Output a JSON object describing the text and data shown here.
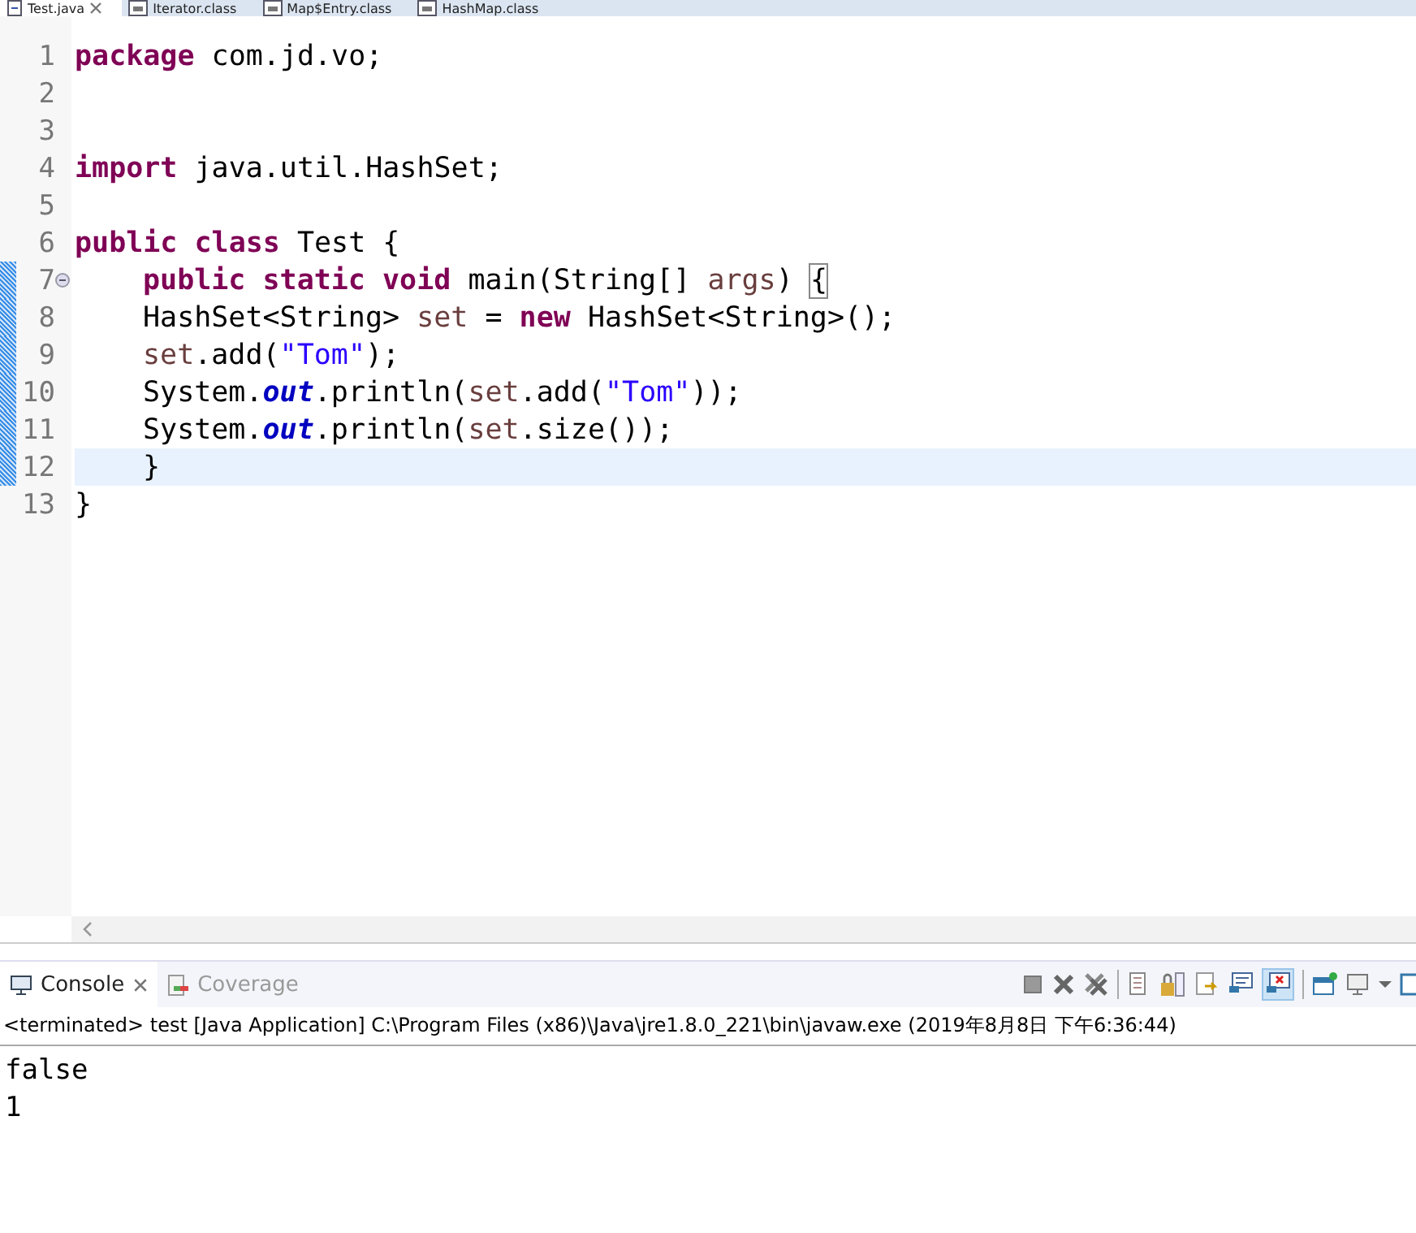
{
  "editor_tabs": [
    {
      "label": "Test.java",
      "selected": true,
      "closable": true
    },
    {
      "label": "Iterator.class",
      "selected": false,
      "closable": false
    },
    {
      "label": "Map$Entry.class",
      "selected": false,
      "closable": false
    },
    {
      "label": "HashMap.class",
      "selected": false,
      "closable": false
    }
  ],
  "code_lines": [
    {
      "number": "1",
      "changed": false,
      "current": false,
      "fold": false,
      "indent": false,
      "tokens": [
        {
          "kind": "kw",
          "text": "package"
        },
        {
          "kind": "txt",
          "text": " com.jd.vo;"
        }
      ]
    },
    {
      "number": "2",
      "changed": false,
      "current": false,
      "fold": false,
      "indent": false
    },
    {
      "number": "3",
      "changed": false,
      "current": false,
      "fold": false,
      "indent": false
    },
    {
      "number": "4",
      "changed": false,
      "current": false,
      "fold": false,
      "indent": false,
      "tokens": [
        {
          "kind": "kw",
          "text": "import"
        },
        {
          "kind": "txt",
          "text": " java.util.HashSet;"
        }
      ]
    },
    {
      "number": "5",
      "changed": false,
      "current": false,
      "fold": false,
      "indent": false
    },
    {
      "number": "6",
      "changed": false,
      "current": false,
      "fold": false,
      "indent": false,
      "tokens": [
        {
          "kind": "kw",
          "text": "public class"
        },
        {
          "kind": "txt",
          "text": " Test {"
        }
      ]
    },
    {
      "number": "7",
      "changed": true,
      "current": false,
      "fold": true,
      "indent": true,
      "tokens": [
        {
          "kind": "kw",
          "text": "public static void"
        },
        {
          "kind": "txt",
          "text": " main(String[] "
        },
        {
          "kind": "var",
          "text": "args"
        },
        {
          "kind": "txt",
          "text": ") "
        },
        {
          "kind": "bracket",
          "text": "{"
        }
      ]
    },
    {
      "number": "8",
      "changed": true,
      "current": false,
      "fold": false,
      "indent": true,
      "tokens": [
        {
          "kind": "txt",
          "text": "HashSet<String> "
        },
        {
          "kind": "var",
          "text": "set"
        },
        {
          "kind": "txt",
          "text": " = "
        },
        {
          "kind": "kw",
          "text": "new"
        },
        {
          "kind": "txt",
          "text": " HashSet<String>();"
        }
      ]
    },
    {
      "number": "9",
      "changed": true,
      "current": false,
      "fold": false,
      "indent": true,
      "tokens": [
        {
          "kind": "var",
          "text": "set"
        },
        {
          "kind": "txt",
          "text": ".add("
        },
        {
          "kind": "str",
          "text": "\"Tom\""
        },
        {
          "kind": "txt",
          "text": ");"
        }
      ]
    },
    {
      "number": "10",
      "changed": true,
      "current": false,
      "fold": false,
      "indent": true,
      "tokens": [
        {
          "kind": "txt",
          "text": "System."
        },
        {
          "kind": "fld",
          "text": "out"
        },
        {
          "kind": "txt",
          "text": ".println("
        },
        {
          "kind": "var",
          "text": "set"
        },
        {
          "kind": "txt",
          "text": ".add("
        },
        {
          "kind": "str",
          "text": "\"Tom\""
        },
        {
          "kind": "txt",
          "text": "));"
        }
      ]
    },
    {
      "number": "11",
      "changed": true,
      "current": false,
      "fold": false,
      "indent": true,
      "tokens": [
        {
          "kind": "txt",
          "text": "System."
        },
        {
          "kind": "fld",
          "text": "out"
        },
        {
          "kind": "txt",
          "text": ".println("
        },
        {
          "kind": "var",
          "text": "set"
        },
        {
          "kind": "txt",
          "text": ".size());"
        }
      ]
    },
    {
      "number": "12",
      "changed": true,
      "current": true,
      "fold": false,
      "indent": true,
      "tokens": [
        {
          "kind": "txt",
          "text": "}"
        }
      ]
    },
    {
      "number": "13",
      "changed": false,
      "current": false,
      "fold": false,
      "indent": false,
      "tokens": [
        {
          "kind": "txt",
          "text": "}"
        }
      ]
    }
  ],
  "console": {
    "tabs": [
      {
        "label": "Console",
        "selected": true,
        "closable": true
      },
      {
        "label": "Coverage",
        "selected": false,
        "closable": false
      }
    ],
    "status": "<terminated> test [Java Application] C:\\Program Files (x86)\\Java\\jre1.8.0_221\\bin\\javaw.exe (2019年8月8日 下午6:36:44)",
    "output": [
      "false",
      "1"
    ]
  }
}
